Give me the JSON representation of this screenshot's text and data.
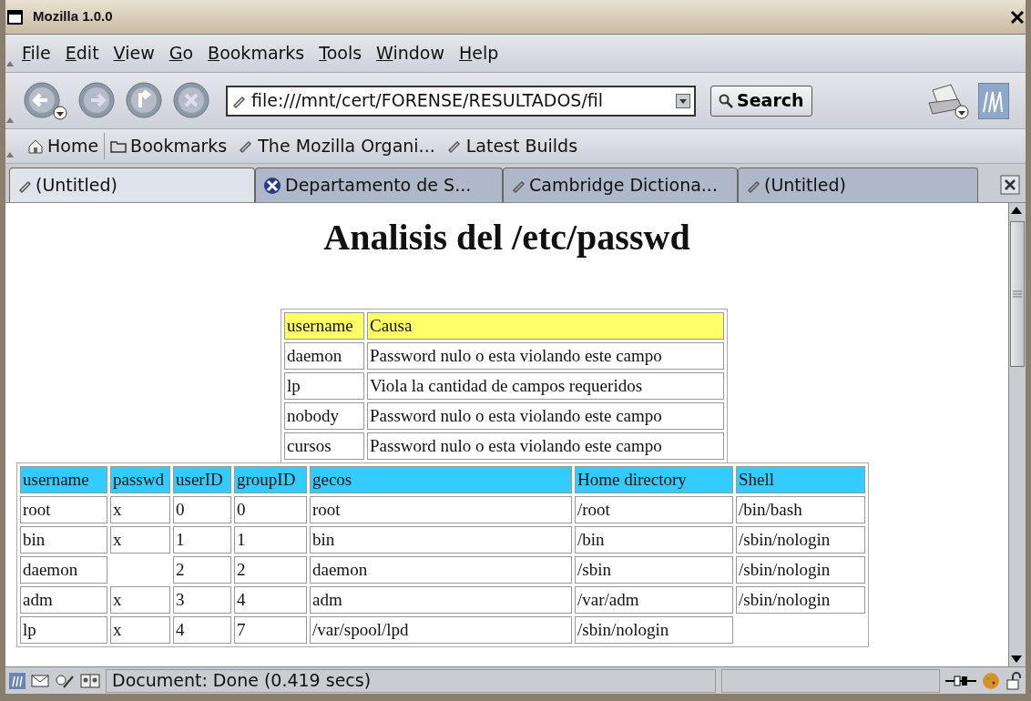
{
  "window": {
    "title": "Mozilla 1.0.0"
  },
  "menu": [
    "File",
    "Edit",
    "View",
    "Go",
    "Bookmarks",
    "Tools",
    "Window",
    "Help"
  ],
  "toolbar": {
    "url": "file:///mnt/cert/FORENSE/RESULTADOS/fil",
    "search_button": "Search"
  },
  "personal_bar": [
    {
      "kind": "home",
      "label": "Home"
    },
    {
      "kind": "folder",
      "label": "Bookmarks"
    },
    {
      "kind": "link",
      "label": "The Mozilla Organi..."
    },
    {
      "kind": "link",
      "label": "Latest Builds"
    }
  ],
  "tabs": [
    {
      "kind": "page",
      "label": "(Untitled)",
      "selected": true
    },
    {
      "kind": "site",
      "label": "Departamento de S...",
      "selected": false
    },
    {
      "kind": "page",
      "label": "Cambridge Dictiona...",
      "selected": false
    },
    {
      "kind": "page",
      "label": "(Untitled)",
      "selected": false
    }
  ],
  "page": {
    "heading": "Analisis del /etc/passwd",
    "causes_table": {
      "columns": [
        "username",
        "Causa"
      ],
      "rows": [
        [
          "daemon",
          "Password nulo o esta violando este campo"
        ],
        [
          "lp",
          "Viola la cantidad de campos requeridos"
        ],
        [
          "nobody",
          "Password nulo o esta violando este campo"
        ],
        [
          "cursos",
          "Password nulo o esta violando este campo"
        ]
      ]
    },
    "passwd_table": {
      "columns": [
        "username",
        "passwd",
        "userID",
        "groupID",
        "gecos",
        "Home directory",
        "Shell"
      ],
      "rows": [
        [
          "root",
          "x",
          "0",
          "0",
          "root",
          "/root",
          "/bin/bash"
        ],
        [
          "bin",
          "x",
          "1",
          "1",
          "bin",
          "/bin",
          "/sbin/nologin"
        ],
        [
          "daemon",
          "",
          "2",
          "2",
          "daemon",
          "/sbin",
          "/sbin/nologin"
        ],
        [
          "adm",
          "x",
          "3",
          "4",
          "adm",
          "/var/adm",
          "/sbin/nologin"
        ],
        [
          "lp",
          "x",
          "4",
          "7",
          "/var/spool/lpd",
          "/sbin/nologin",
          ""
        ]
      ]
    }
  },
  "status_bar": {
    "text": "Document: Done (0.419 secs)"
  }
}
